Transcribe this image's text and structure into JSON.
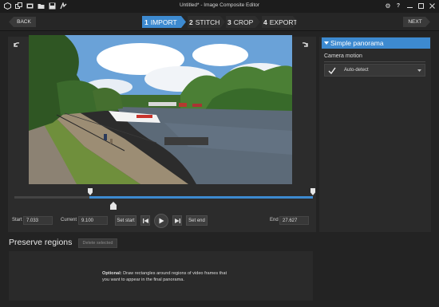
{
  "window": {
    "title": "Untitled* - Image Composite Editor"
  },
  "nav": {
    "back_label": "BACK",
    "next_label": "NEXT",
    "steps": [
      {
        "num": "1",
        "label": "IMPORT"
      },
      {
        "num": "2",
        "label": "STITCH"
      },
      {
        "num": "3",
        "label": "CROP"
      },
      {
        "num": "4",
        "label": "EXPORT"
      }
    ]
  },
  "timeline": {
    "start_label": "Start",
    "start_value": "7.033",
    "current_label": "Current",
    "current_value": "9.100",
    "end_label": "End",
    "end_value": "27.627",
    "set_start_label": "Set start",
    "set_end_label": "Set end"
  },
  "right_panel": {
    "header": "Simple panorama",
    "camera_motion_label": "Camera motion",
    "camera_motion_value": "Auto-detect"
  },
  "preserve": {
    "title": "Preserve regions",
    "delete_label": "Delete selected",
    "hint_bold": "Optional:",
    "hint_rest": " Draw rectangles around regions of video frames that you want to appear in the final panorama."
  },
  "colors": {
    "accent": "#3d8ad0",
    "background": "#232323",
    "panel": "#2c2c2c"
  }
}
